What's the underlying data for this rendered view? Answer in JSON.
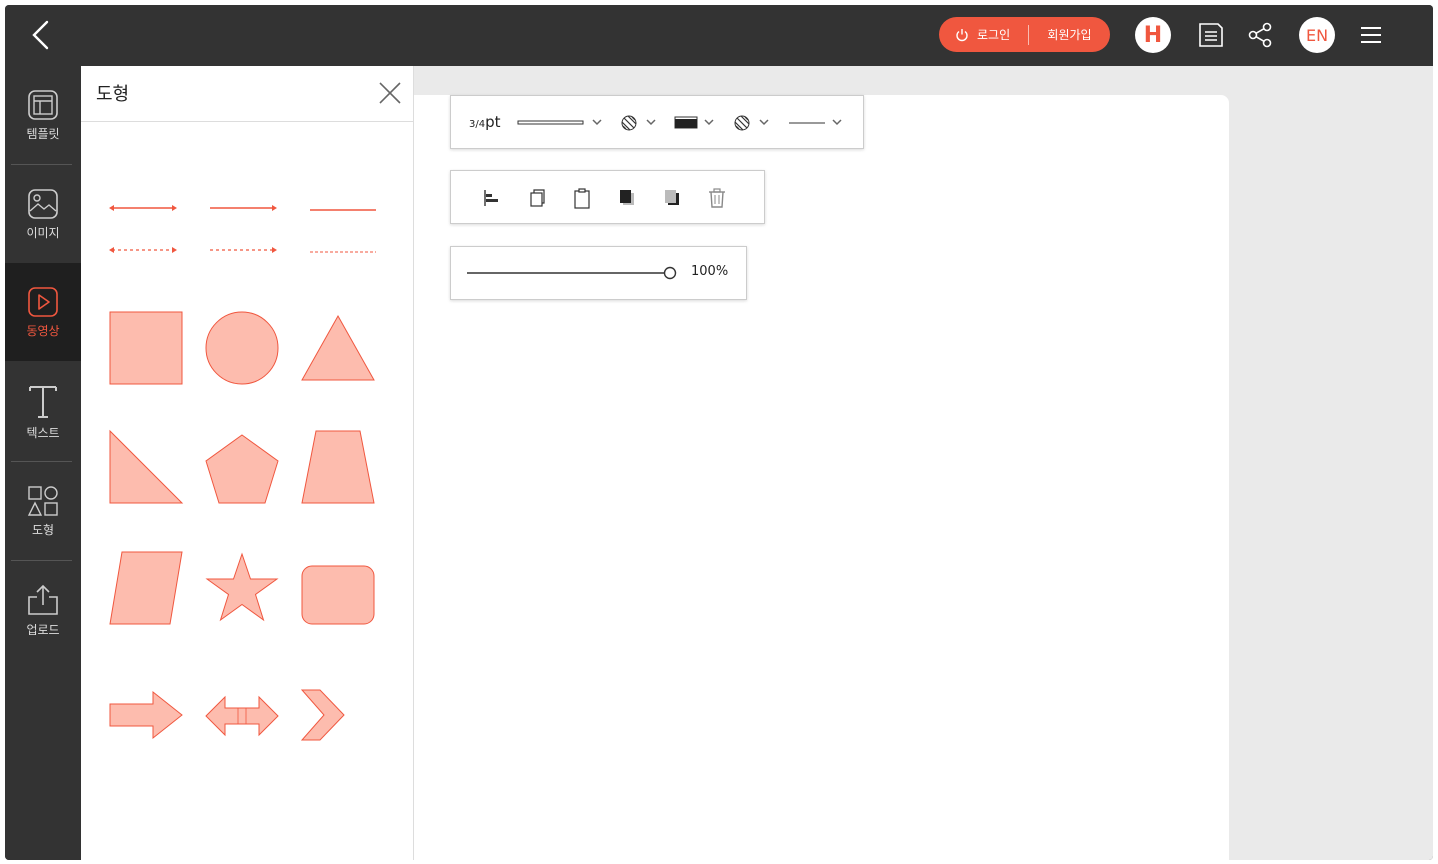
{
  "topbar": {
    "login_label": "로그인",
    "signup_label": "회원가입",
    "h_label": "H",
    "lang_label": "EN"
  },
  "sidebar": {
    "items": [
      {
        "label": "템플릿",
        "icon": "template-icon"
      },
      {
        "label": "이미지",
        "icon": "image-icon"
      },
      {
        "label": "동영상",
        "icon": "video-icon",
        "active": true
      },
      {
        "label": "텍스트",
        "icon": "text-icon"
      },
      {
        "label": "도형",
        "icon": "shapes-icon"
      },
      {
        "label": "업로드",
        "icon": "upload-icon"
      }
    ]
  },
  "panel": {
    "title": "도형"
  },
  "toolbar": {
    "line_width_prefix": "3/4",
    "line_width_unit": "pt",
    "opacity": "100%",
    "opacity_level": 1.0
  },
  "colors": {
    "accent": "#f0573f",
    "shape_fill": "#fdbcae",
    "shape_stroke": "#f0573f",
    "dark_bg": "#333333"
  }
}
